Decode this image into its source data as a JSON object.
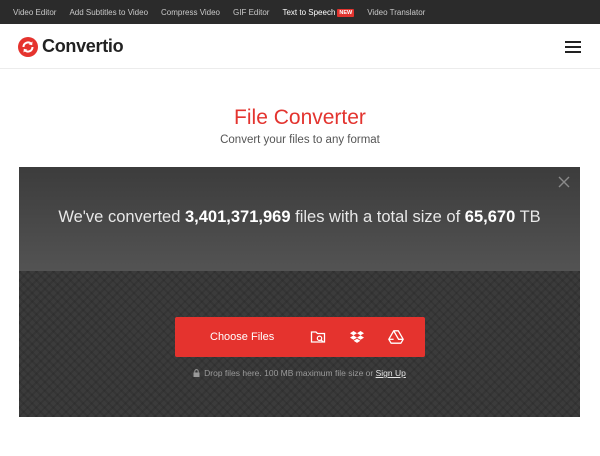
{
  "topbar": {
    "items": [
      {
        "label": "Video Editor"
      },
      {
        "label": "Add Subtitles to Video"
      },
      {
        "label": "Compress Video"
      },
      {
        "label": "GIF Editor"
      },
      {
        "label": "Text to Speech",
        "badge": "NEW"
      },
      {
        "label": "Video Translator"
      }
    ]
  },
  "header": {
    "logo_text": "Convertio",
    "logo_icon": "convertio-logo-icon",
    "menu_icon": "hamburger-menu-icon"
  },
  "hero": {
    "title": "File Converter",
    "subtitle": "Convert your files to any format"
  },
  "stats": {
    "prefix": "We've converted",
    "files_count": "3,401,371,969",
    "middle": "files with a total size of",
    "total_size": "65,670",
    "unit": "TB"
  },
  "upload": {
    "choose_label": "Choose Files",
    "sources": [
      "folder-search-icon",
      "dropbox-icon",
      "google-drive-icon"
    ],
    "note": "Drop files here. 100 MB maximum file size or",
    "signup_label": "Sign Up"
  },
  "colors": {
    "accent": "#e5332e",
    "topbar_bg": "#2b2b2b",
    "box_bg": "#3a3a3a"
  }
}
